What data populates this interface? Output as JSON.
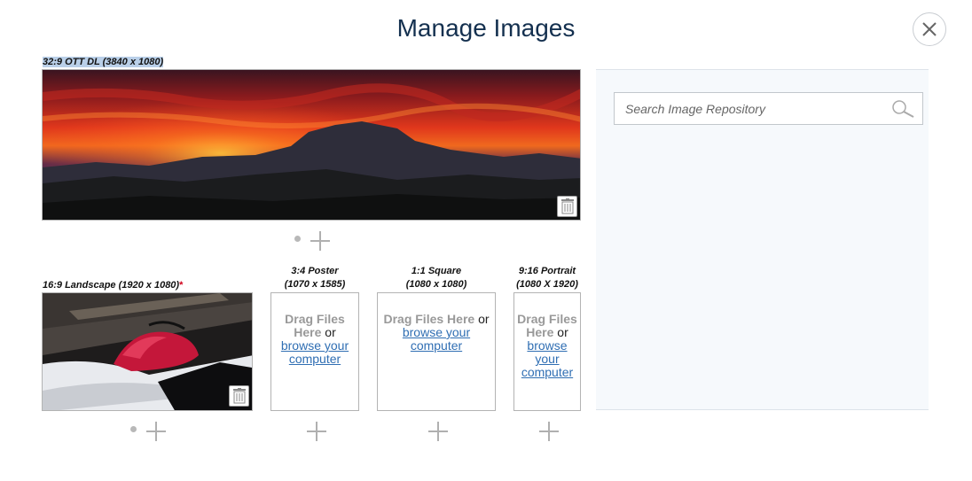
{
  "modal": {
    "title": "Manage Images"
  },
  "slots": {
    "ott": {
      "label": "32:9 OTT DL (3840 x 1080)"
    },
    "landscape": {
      "label": "16:9 Landscape (1920 x 1080)",
      "required_mark": "*"
    },
    "poster": {
      "label_line1": "3:4 Poster",
      "label_line2": "(1070 x 1585)"
    },
    "square": {
      "label_line1": "1:1 Square",
      "label_line2": "(1080 x 1080)"
    },
    "portrait": {
      "label_line1": "9:16 Portrait",
      "label_line2": "(1080 X 1920)"
    }
  },
  "dropzone": {
    "drag_text": "Drag Files Here",
    "drag_line1": "Drag Files",
    "drag_line2": "Here",
    "or_text": "or",
    "browse_text": "browse your computer",
    "browse_line1": "browse your",
    "browse_line2": "computer",
    "browse_word1": "browse",
    "browse_word2": "your",
    "browse_word3": "computer"
  },
  "search": {
    "placeholder": "Search Image Repository"
  },
  "icons": {
    "close": "close-icon",
    "trash": "trash-icon",
    "add": "plus-icon",
    "search": "search-icon"
  },
  "colors": {
    "title": "#14304f",
    "link": "#2f6eb3",
    "required": "#d0021b",
    "repo_bg": "#f6f9fc"
  }
}
